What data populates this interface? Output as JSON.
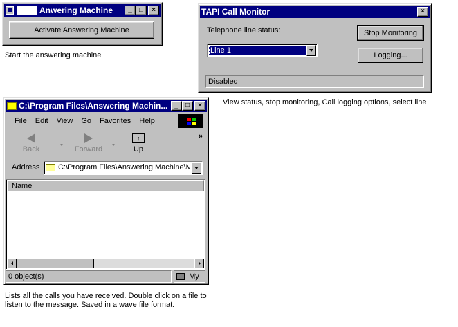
{
  "answering_machine": {
    "title": "Anwering Machine",
    "activate_button": "Activate Answering Machine",
    "caption": "Start the answering machine"
  },
  "tapi_monitor": {
    "title": "TAPI Call Monitor",
    "line_status_label": "Telephone line status:",
    "line_select_value": "Line 1",
    "stop_button": "Stop Monitoring",
    "logging_button": "Logging...",
    "status_text": "Disabled",
    "caption": "View status, stop monitoring, Call logging options, select line"
  },
  "explorer": {
    "title": "C:\\Program Files\\Answering Machin...",
    "menu": [
      "File",
      "Edit",
      "View",
      "Go",
      "Favorites",
      "Help"
    ],
    "toolbar": {
      "back": "Back",
      "forward": "Forward",
      "up": "Up",
      "more": "»"
    },
    "address_label": "Address",
    "address_value": "C:\\Program Files\\Answering Machine\\M",
    "column_name": "Name",
    "status_objects": "0 object(s)",
    "status_zone": "My",
    "caption_line1": "Lists all the calls you have received.  Double click on a file to",
    "caption_line2": "listen to the message.  Saved in a wave file format."
  },
  "titlebar_buttons": {
    "minimize": "_",
    "maximize": "□",
    "close": "×"
  }
}
